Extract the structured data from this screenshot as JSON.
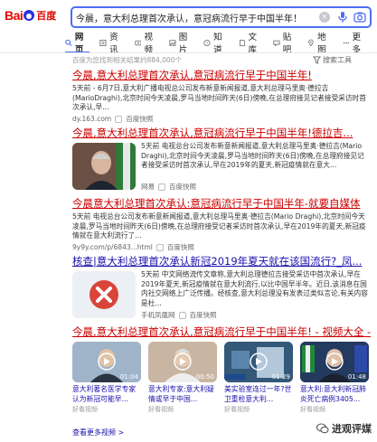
{
  "logo": {
    "bai": "Bai",
    "du": "du",
    "cn": "百度"
  },
  "search": {
    "query": "今晨，意大利总理首次承认，意冠病流行早于中国半年！"
  },
  "nav": {
    "tabs": [
      {
        "label": "网页",
        "icon": "search-icon"
      },
      {
        "label": "资讯",
        "icon": "news-icon"
      },
      {
        "label": "视频",
        "icon": "video-icon"
      },
      {
        "label": "图片",
        "icon": "image-icon"
      },
      {
        "label": "知道",
        "icon": "zhidao-icon"
      },
      {
        "label": "文库",
        "icon": "wenku-icon"
      },
      {
        "label": "贴吧",
        "icon": "tieba-icon"
      },
      {
        "label": "地图",
        "icon": "map-icon"
      },
      {
        "label": "更多",
        "icon": "more-icon"
      }
    ]
  },
  "meta": {
    "count": "百度为您找到相关结果约884,000个"
  },
  "tools": {
    "label": "搜索工具"
  },
  "results": [
    {
      "title_a": "今晨,意大利总理首次承认,意冠病流行早于中国半年!",
      "desc": "5天前 - 6月7日,意大利广播电视总公司发布新意新闻报道,意大利总理马里奥·德拉吉(MarioDraghi),北京时间今天凌晨,罗马当地时间昨天(6日)傍晚,在总理府接见记者接受采访时首次承认,早...",
      "source": "dy.163.com",
      "cache": "百度快照"
    },
    {
      "title_a": "今晨,意大利总理首次承认,意冠病流行早于中国半年!德拉吉...",
      "desc": "5天前 电视总台公司发布新意新闻报道,意大利总理马里奥·德拉吉(Mario Draghi),北京时间今天凌晨,罗马当地时间昨天(6日)傍晚,在总理府接见记者接受采访时首次承认,早在2019年的夏天,新冠疫情就在意大...",
      "source": "网易",
      "cache": "百度快照"
    },
    {
      "title_a": "今晨意大利总理首次承认:意冠病流行早于中国半年-就要自媒体",
      "desc": "5天前 电视总台公司发布新意新闻报道,意大利总理马里奥·德拉吉(Mario Draghi),北京时间今天凌晨,罗马当地时间昨天(6日)傍晚,在总理府接受记者采访时首次承认,早在2019年的夏天,新冠疫情就在意大利流行了...",
      "source": "9y9y.com/p/6843...html",
      "cache": "百度快照"
    },
    {
      "title_a": "核查|意大利总理首次承认新冠2019年夏天就在该国流行?_凤...",
      "desc": "5天前 中文网络流传文章称,意大利总理德拉吉接受采访中首次承认,早在2019年夏天,新冠疫情就在意大利流行,以比中国早半年。近日,该消息在国内社交网络上广泛传播。经核查,意大利总理没有发表过类似言论,有关内容是杜...",
      "source": "手机凤凰网",
      "cache": "百度快照"
    }
  ],
  "video_section": {
    "title": "今晨,意大利总理首次承认,意冠病流行早于中国半年! - 视频大全 -...",
    "videos": [
      {
        "title": "意大利著名医学专家认为新冠可能早...",
        "source": "好看视频",
        "duration": "01:04"
      },
      {
        "title": "意大利专家:意大利疑情或早于中国...",
        "source": "好看视频",
        "duration": "00:50"
      },
      {
        "title": "美实验室连过一年?世卫重检意大利...",
        "source": "好看视频",
        "duration": "01:29"
      },
      {
        "title": "意大利:意大利新冠肺炎死亡病例3405...",
        "source": "好看视频",
        "duration": "01:48"
      }
    ],
    "more": "查看更多视频 >"
  },
  "watermark": "进观评媒",
  "colors": {
    "accent": "#4e6ef2",
    "red": "#c00",
    "link": "#1a0dab"
  }
}
